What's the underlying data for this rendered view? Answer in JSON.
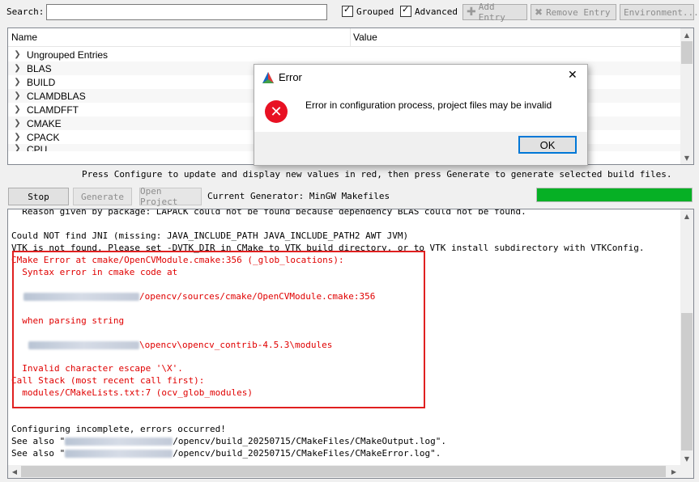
{
  "toolbar": {
    "search_label": "Search:",
    "search_value": "",
    "grouped_label": "Grouped",
    "advanced_label": "Advanced",
    "add_entry_label": "Add Entry",
    "remove_entry_label": "Remove Entry",
    "environment_label": "Environment..."
  },
  "tree": {
    "col_name": "Name",
    "col_value": "Value",
    "rows": [
      {
        "label": "Ungrouped Entries"
      },
      {
        "label": "BLAS"
      },
      {
        "label": "BUILD"
      },
      {
        "label": "CLAMDBLAS"
      },
      {
        "label": "CLAMDFFT"
      },
      {
        "label": "CMAKE"
      },
      {
        "label": "CPACK"
      },
      {
        "label": "CPU"
      }
    ]
  },
  "hint": "Press Configure to update and display new values in red, then press Generate to generate selected build files.",
  "actions": {
    "stop_label": "Stop",
    "generate_label": "Generate",
    "open_project_label": "Open Project",
    "current_generator": "Current Generator: MinGW Makefiles",
    "progress": 1.0
  },
  "output": {
    "lines": [
      "  Reason given by package: LAPACK could not be found because dependency BLAS could not be found.",
      "",
      "Could NOT find JNI (missing: JAVA_INCLUDE_PATH JAVA_INCLUDE_PATH2 AWT JVM)",
      "VTK is not found. Please set -DVTK_DIR in CMake to VTK build directory, or to VTK install subdirectory with VTKConfig.",
      "CMake Error at cmake/OpenCVModule.cmake:356 (_glob_locations):",
      "  Syntax error in cmake code at",
      "/opencv/sources/cmake/OpenCVModule.cmake:356",
      "  when parsing string",
      "\\opencv\\opencv_contrib-4.5.3\\modules",
      "  Invalid character escape '\\X'.",
      "Call Stack (most recent call first):",
      "  modules/CMakeLists.txt:7 (ocv_glob_modules)",
      "Configuring incomplete, errors occurred!",
      "See also \"",
      "/opencv/build_20250715/CMakeFiles/CMakeOutput.log\".",
      "See also \"",
      "/opencv/build_20250715/CMakeFiles/CMakeError.log\"."
    ]
  },
  "dialog": {
    "title": "Error",
    "message": "Error in configuration process, project files may be invalid",
    "ok_label": "OK",
    "close_glyph": "✕"
  },
  "colors": {
    "error_text": "#e00000",
    "progress": "#06b025",
    "highlight_box": "#e02020"
  }
}
